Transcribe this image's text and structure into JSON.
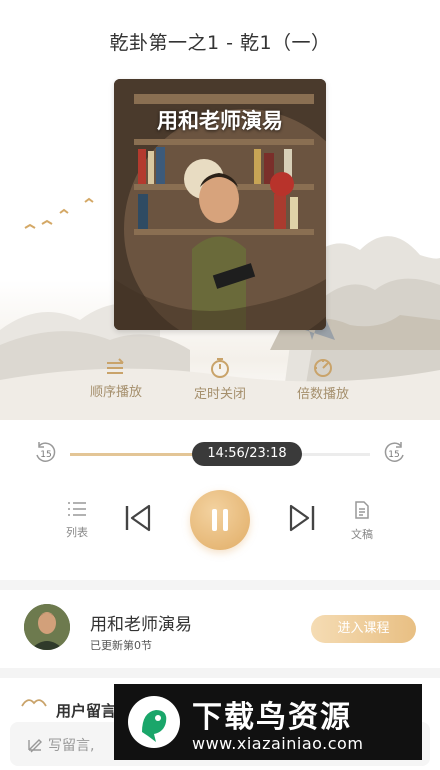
{
  "player": {
    "title": "乾卦第一之1 - 乾1（一）",
    "cover_title": "用和老师演易",
    "controls": [
      {
        "label": "顺序播放",
        "icon": "sequence-icon"
      },
      {
        "label": "定时关闭",
        "icon": "timer-icon"
      },
      {
        "label": "倍数播放",
        "icon": "speed-icon"
      }
    ],
    "skip_back_label": "15",
    "skip_forward_label": "15",
    "time": "14:56/23:18",
    "progress": 0.641,
    "list_label": "列表",
    "script_label": "文稿",
    "accent_color": "#e1ad66"
  },
  "teacher": {
    "name": "用和老师演易",
    "subtitle": "已更新第0节",
    "enter_label": "进入课程"
  },
  "comments": {
    "label": "用户留言",
    "placeholder": "写留言,"
  },
  "watermark": {
    "main": "下载鸟资源",
    "url": "www.xiazainiao.com"
  }
}
